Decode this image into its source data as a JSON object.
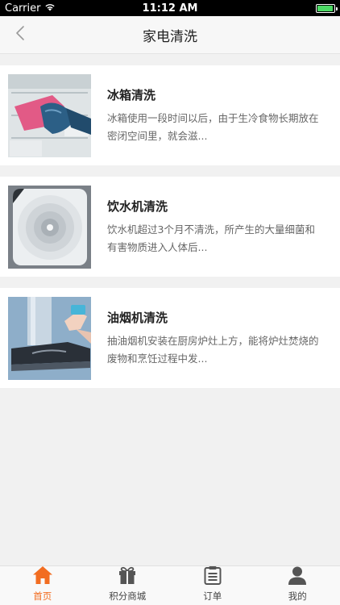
{
  "status_bar": {
    "carrier": "Carrier",
    "time": "11:12 AM",
    "battery_level": 0.95
  },
  "nav": {
    "title": "家电清洗",
    "back_icon": "chevron-left-icon"
  },
  "items": [
    {
      "title": "冰箱清洗",
      "desc": "冰箱使用一段时间以后，由于生冷食物长期放在密闭空间里，就会滋...",
      "image": "refrigerator-cleaning-photo"
    },
    {
      "title": "饮水机清洗",
      "desc": "饮水机超过3个月不清洗，所产生的大量细菌和有害物质进入人体后...",
      "image": "water-dispenser-photo"
    },
    {
      "title": "油烟机清洗",
      "desc": "抽油烟机安装在厨房炉灶上方，能将炉灶焚烧的废物和烹饪过程中发...",
      "image": "range-hood-photo"
    }
  ],
  "tabs": [
    {
      "label": "首页",
      "icon": "home-icon",
      "active": true
    },
    {
      "label": "积分商城",
      "icon": "gift-icon",
      "active": false
    },
    {
      "label": "订单",
      "icon": "clipboard-icon",
      "active": false
    },
    {
      "label": "我的",
      "icon": "user-icon",
      "active": false
    }
  ],
  "colors": {
    "accent": "#f26d21",
    "background": "#f1f1f1",
    "tab_inactive": "#555555"
  }
}
